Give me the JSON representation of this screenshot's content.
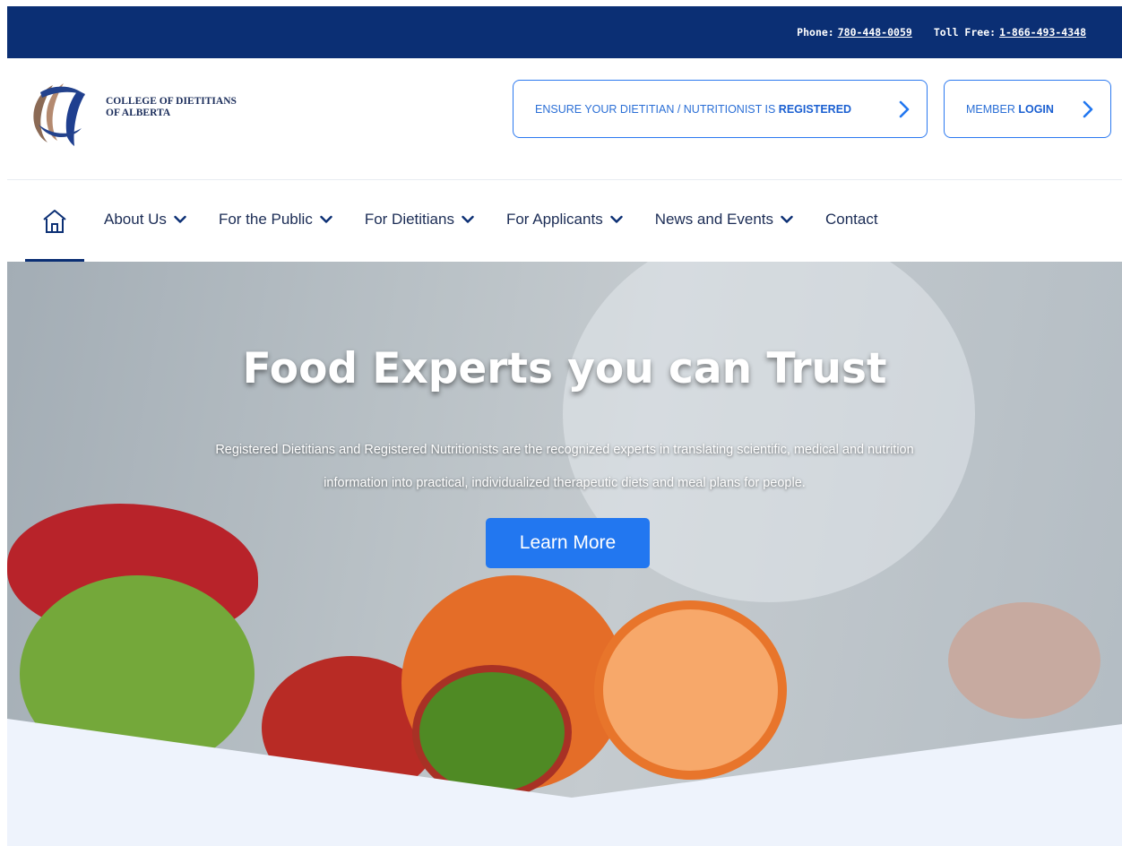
{
  "topbar": {
    "phone_label": "Phone:",
    "phone_number": "780-448-0059",
    "tollfree_label": "Toll Free:",
    "tollfree_number": "1-866-493-4348"
  },
  "header": {
    "logo_line1": "COLLEGE OF DIETITIANS",
    "logo_line2": "OF ALBERTA",
    "register_cta": {
      "text": "ENSURE YOUR DIETITIAN / NUTRITIONIST IS ",
      "strong": "REGISTERED"
    },
    "login_cta": {
      "text": "MEMBER ",
      "strong": "LOGIN"
    }
  },
  "nav": {
    "items": [
      {
        "label": "About Us",
        "has_dropdown": true
      },
      {
        "label": "For the Public",
        "has_dropdown": true
      },
      {
        "label": "For Dietitians",
        "has_dropdown": true
      },
      {
        "label": "For Applicants",
        "has_dropdown": true
      },
      {
        "label": "News and Events",
        "has_dropdown": true
      },
      {
        "label": "Contact",
        "has_dropdown": false
      }
    ]
  },
  "hero": {
    "title": "Food Experts you can Trust",
    "description_line1": "Registered Dietitians and Registered Nutritionists are the recognized experts in translating scientific, medical and nutrition",
    "description_line2": "information into practical, individualized therapeutic diets and meal plans for people.",
    "button": "Learn More"
  },
  "colors": {
    "topbar_bg": "#0b2f74",
    "accent_blue": "#2277f0",
    "wave_bg": "#eef3fc"
  },
  "icons": {
    "home": "home-icon",
    "chevron_right": "chevron-right-icon",
    "chevron_down": "chevron-down-icon"
  }
}
